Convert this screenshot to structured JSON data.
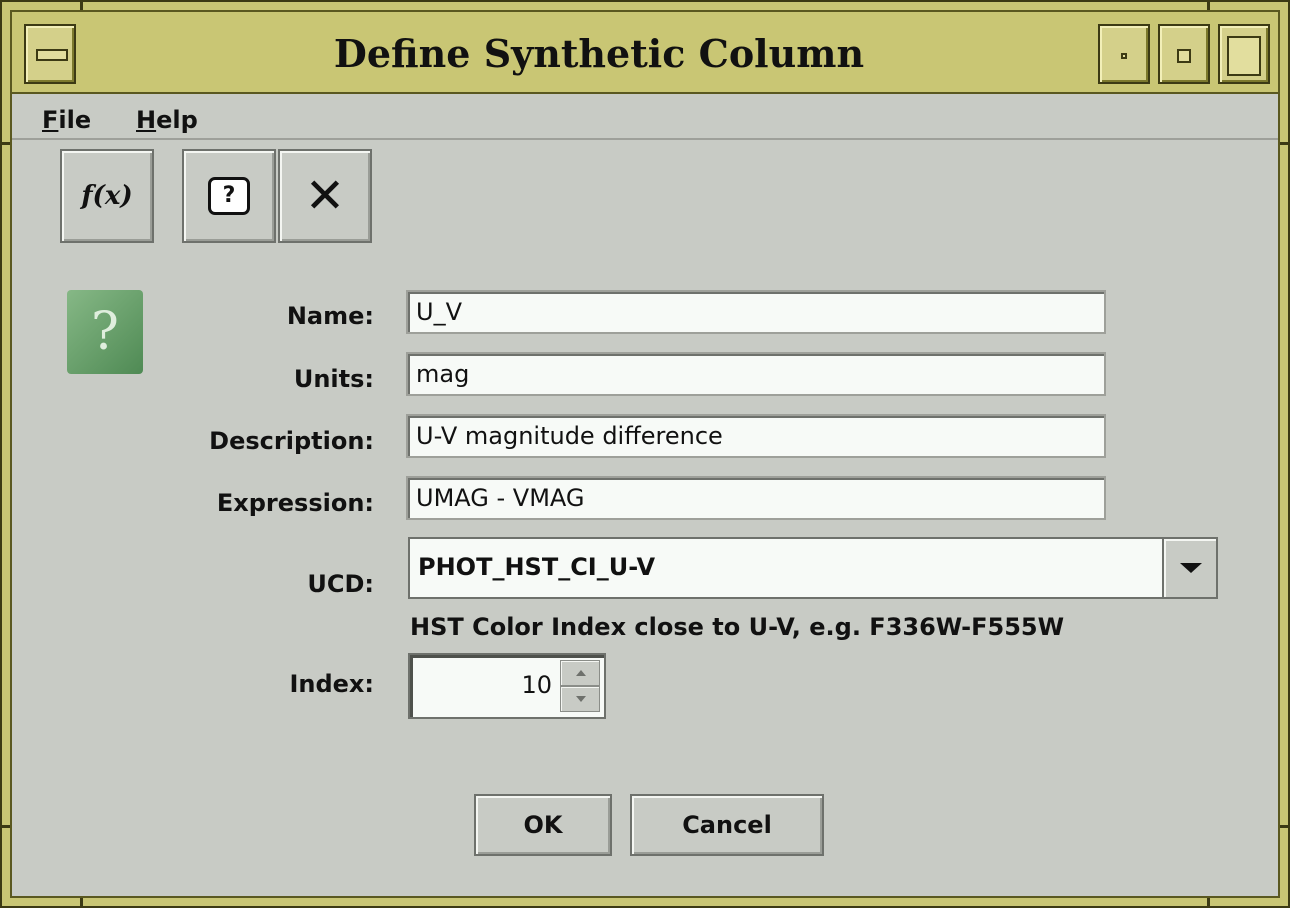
{
  "window": {
    "title": "Define Synthetic Column"
  },
  "menu": {
    "file": {
      "mnemonic": "F",
      "rest": "ile"
    },
    "help": {
      "mnemonic": "H",
      "rest": "elp"
    }
  },
  "toolbar": {
    "function_icon_text": "f(x)",
    "help_icon_text": "?",
    "close_icon_text": "✕"
  },
  "form": {
    "help_badge_text": "?",
    "name": {
      "label": "Name:",
      "value": "U_V"
    },
    "units": {
      "label": "Units:",
      "value": "mag"
    },
    "description": {
      "label": "Description:",
      "value": "U-V magnitude difference"
    },
    "expression": {
      "label": "Expression:",
      "value": "UMAG - VMAG"
    },
    "ucd": {
      "label": "UCD:",
      "value": "PHOT_HST_CI_U-V",
      "description": "HST Color Index close to U-V, e.g. F336W-F555W"
    },
    "index": {
      "label": "Index:",
      "value": "10"
    }
  },
  "buttons": {
    "ok": "OK",
    "cancel": "Cancel"
  }
}
